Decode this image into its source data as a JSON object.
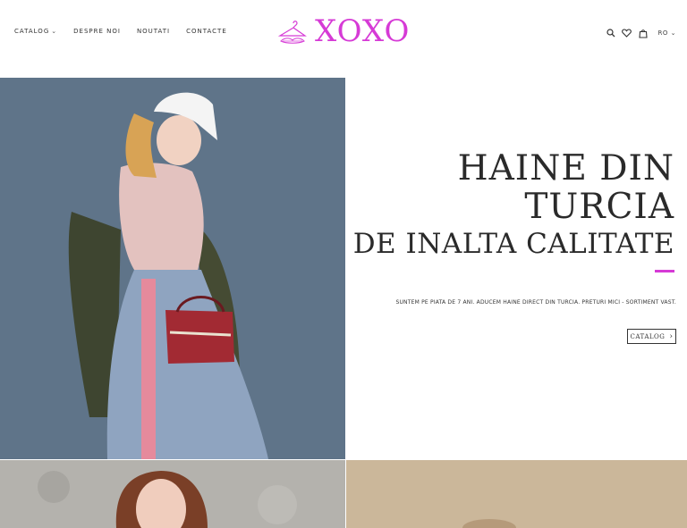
{
  "nav": {
    "catalog": "CATALOG",
    "about": "DESPRE NOI",
    "news": "NOUTATI",
    "contacts": "CONTACTE"
  },
  "logo": {
    "text": "XOXO"
  },
  "header": {
    "language": "RO"
  },
  "icons": [
    "search-icon",
    "heart-icon",
    "bag-icon",
    "hanger-logo-icon"
  ],
  "hero": {
    "title_line1": "HAINE DIN",
    "title_line2": "TURCIA",
    "subtitle": "DE INALTA CALITATE",
    "description": "SUNTEM PE PIATA DE 7 ANI. ADUCEM HAINE DIRECT DIN TURCIA. PRETURI MICI - SORTIMENT VAST.",
    "cta_label": "CATALOG"
  },
  "colors": {
    "accent": "#d63ad6",
    "hero_bg": "#5e7388"
  }
}
